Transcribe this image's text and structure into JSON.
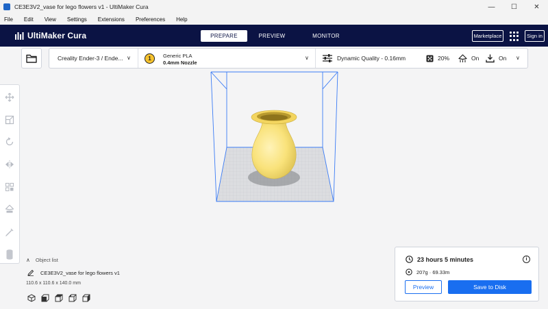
{
  "window": {
    "title": "CE3E3V2_vase for lego flowers v1 - UltiMaker Cura",
    "minimize": "—",
    "maximize": "☐",
    "close": "✕"
  },
  "menu": [
    "File",
    "Edit",
    "View",
    "Settings",
    "Extensions",
    "Preferences",
    "Help"
  ],
  "header": {
    "brand": "UltiMaker Cura",
    "tabs": [
      "PREPARE",
      "PREVIEW",
      "MONITOR"
    ],
    "active_tab": "PREPARE",
    "marketplace": "Marketplace",
    "signin": "Sign in"
  },
  "toolbar": {
    "printer": "Creality Ender-3 / Ende...",
    "extruder_number": "1",
    "material": "Generic PLA",
    "nozzle": "0.4mm Nozzle",
    "profile": "Dynamic Quality - 0.16mm",
    "infill": "20%",
    "support": "On",
    "adhesion": "On"
  },
  "object_list": {
    "toggle_label": "Object list",
    "item_name": "CE3E3V2_vase for lego flowers v1",
    "dimensions": "110.6 x 110.6 x 140.0 mm"
  },
  "print_summary": {
    "time": "23 hours 5 minutes",
    "material_usage": "207g · 69.33m",
    "preview_button": "Preview",
    "save_button": "Save to Disk"
  },
  "colors": {
    "header_bg": "#0b1344",
    "accent": "#196ef0",
    "model": "#f9e27a",
    "build_volume": "#3a7bf5"
  },
  "icons": {
    "tools": [
      "move-icon",
      "scale-icon",
      "rotate-icon",
      "mirror-icon",
      "per-model-settings-icon",
      "support-blocker-icon",
      "paint-icon",
      "cylinder-icon"
    ]
  }
}
